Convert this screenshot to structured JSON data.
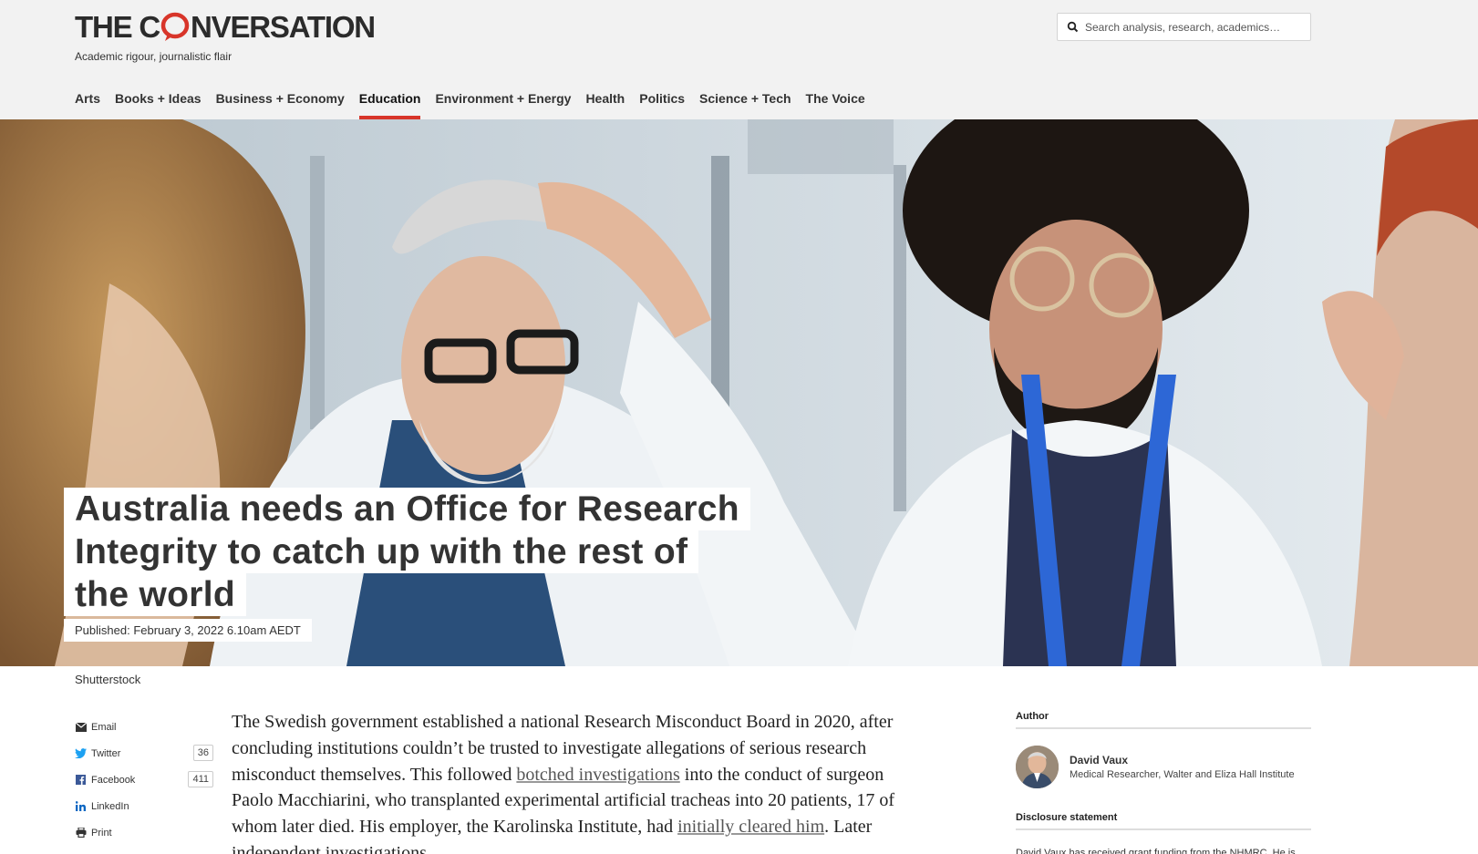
{
  "brand": {
    "name_before": "THE C",
    "name_after": "NVERSATION",
    "tagline": "Academic rigour, journalistic flair",
    "accent": "#d8352a"
  },
  "search": {
    "placeholder": "Search analysis, research, academics…"
  },
  "nav": {
    "items": [
      {
        "label": "Arts"
      },
      {
        "label": "Books + Ideas"
      },
      {
        "label": "Business + Economy"
      },
      {
        "label": "Education",
        "active": true
      },
      {
        "label": "Environment + Energy"
      },
      {
        "label": "Health"
      },
      {
        "label": "Politics"
      },
      {
        "label": "Science + Tech"
      },
      {
        "label": "The Voice"
      }
    ]
  },
  "article": {
    "title_lines": [
      "Australia needs an Office for Research",
      "Integrity to catch up with the rest of",
      "the world"
    ],
    "published": "Published: February 3, 2022 6.10am AEDT",
    "image_credit": "Shutterstock",
    "body": {
      "p1_a": "The Swedish government established a national Research Misconduct Board in 2020, after concluding institutions couldn’t be trusted to investigate allegations of serious research misconduct themselves. This followed ",
      "link1": "botched investigations",
      "p1_b": " into the conduct of surgeon Paolo Macchiarini, who transplanted experimental artificial tracheas into 20 patients, 17 of whom later died. His employer, the Karolinska Institute, had ",
      "link2": "initially cleared him",
      "p1_c": ". Later independent investigations"
    }
  },
  "share": {
    "items": [
      {
        "label": "Email",
        "icon": "email-icon"
      },
      {
        "label": "Twitter",
        "icon": "twitter-icon",
        "count": "36"
      },
      {
        "label": "Facebook",
        "icon": "facebook-icon",
        "count": "411"
      },
      {
        "label": "LinkedIn",
        "icon": "linkedin-icon"
      },
      {
        "label": "Print",
        "icon": "print-icon"
      }
    ]
  },
  "sidebar": {
    "author_heading": "Author",
    "author_name": "David Vaux",
    "author_role": "Medical Researcher, Walter and Eliza Hall Institute",
    "disclosure_heading": "Disclosure statement",
    "disclosure_text": "David Vaux has received grant funding from the NHMRC. He is"
  }
}
